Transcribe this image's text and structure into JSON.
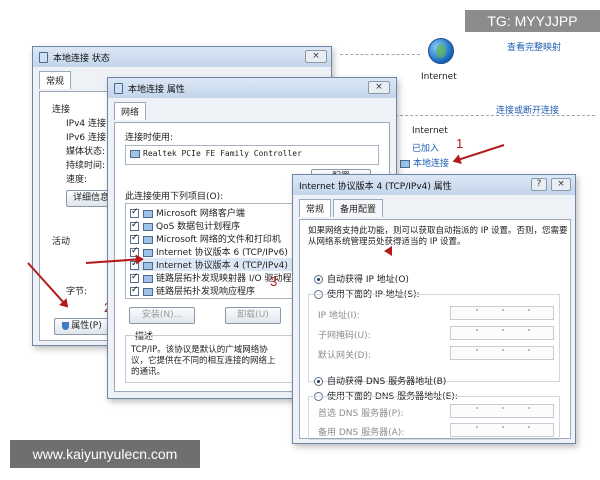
{
  "watermarks": {
    "top_right": "TG: MYYJJPP",
    "bottom_left": "www.kaiyunyulecn.com"
  },
  "network_center": {
    "internet_label": "Internet",
    "full_map_link": "查看完整映射",
    "connect_disconnect_link": "连接或断开连接",
    "access_type_label": "Internet",
    "homegroup_label": "已加入",
    "connection_link": "本地连接",
    "marker_1": "1"
  },
  "status_window": {
    "title": "本地连接 状态",
    "tab": "常规",
    "connection_group": "连接",
    "rows": [
      "IPv4 连接",
      "IPv6 连接",
      "媒体状态:",
      "持续时间:",
      "速度:"
    ],
    "details_button": "详细信息",
    "activity_group": "活动",
    "bytes_label": "字节:",
    "properties_button": "属性(P)",
    "marker_2": "2"
  },
  "properties_window": {
    "title": "本地连接 属性",
    "tab": "网络",
    "connect_using_label": "连接时使用:",
    "adapter": "Realtek PCIe FE Family Controller",
    "configure_button": "配置",
    "items_label": "此连接使用下列项目(O):",
    "items": [
      {
        "label": "Microsoft 网络客户端",
        "checked": true
      },
      {
        "label": "QoS 数据包计划程序",
        "checked": true
      },
      {
        "label": "Microsoft 网络的文件和打印机",
        "checked": true
      },
      {
        "label": "Internet 协议版本 6 (TCP/IPv6)",
        "checked": true
      },
      {
        "label": "Internet 协议版本 4 (TCP/IPv4)",
        "checked": true
      },
      {
        "label": "链路层拓扑发现映射器 I/O 驱动程序",
        "checked": true
      },
      {
        "label": "链路层拓扑发现响应程序",
        "checked": true
      }
    ],
    "install_button": "安装(N)...",
    "uninstall_button": "卸载(U)",
    "description_label": "描述",
    "description_text": "TCP/IP。该协议是默认的广域网络协议，它提供在不同的相互连接的网络上的通讯。",
    "marker_3": "3"
  },
  "ipv4_window": {
    "title": "Internet 协议版本 4 (TCP/IPv4) 属性",
    "help_button": "?",
    "close_button": "×",
    "tabs": [
      "常规",
      "备用配置"
    ],
    "intro": "如果网络支持此功能，则可以获取自动指派的 IP 设置。否则，您需要从网络系统管理员处获得适当的 IP 设置。",
    "auto_ip": "自动获得 IP 地址(O)",
    "manual_ip": "使用下面的 IP 地址(S):",
    "ip_fields": [
      "IP 地址(I):",
      "子网掩码(U):",
      "默认网关(D):"
    ],
    "auto_dns": "自动获得 DNS 服务器地址(B)",
    "manual_dns": "使用下面的 DNS 服务器地址(E):",
    "dns_fields": [
      "首选 DNS 服务器(P):",
      "备用 DNS 服务器(A):"
    ],
    "auto_ip_selected": true,
    "auto_dns_selected": true
  }
}
